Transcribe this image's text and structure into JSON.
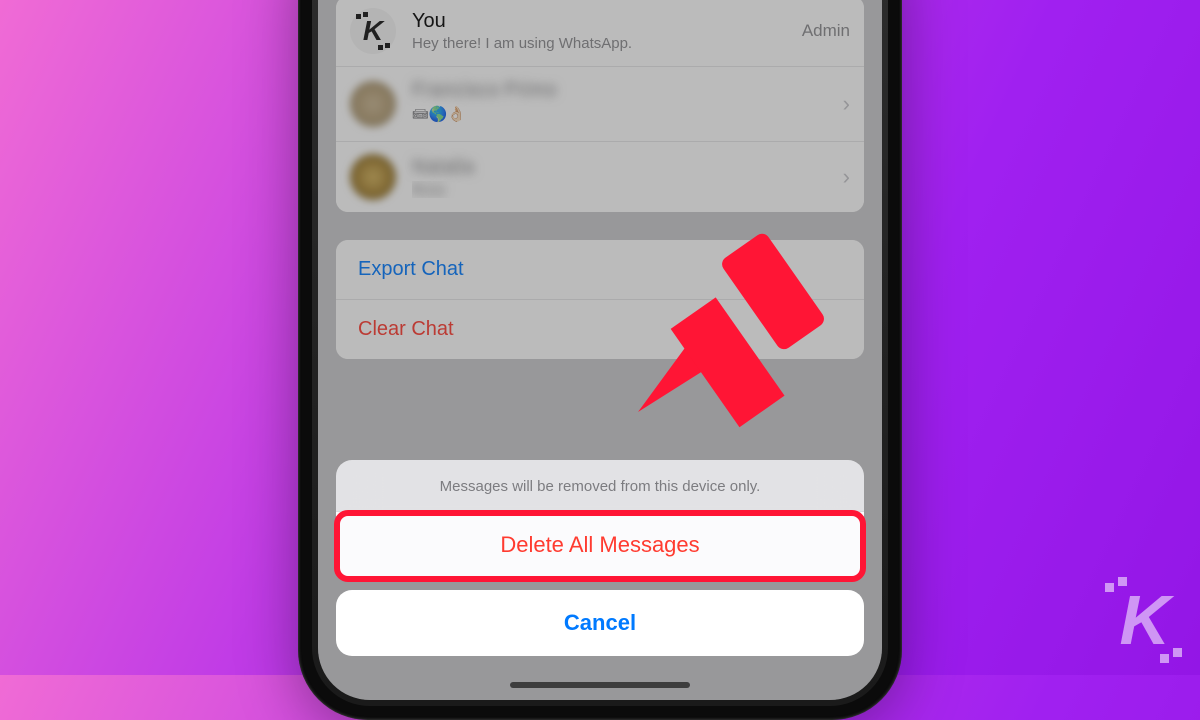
{
  "participants": {
    "you": {
      "name": "You",
      "status": "Hey there! I am using WhatsApp.",
      "role": "Admin"
    },
    "p2": {
      "status_emoji": "📾🌎👌🏻"
    }
  },
  "chat_actions": {
    "export": "Export Chat",
    "clear": "Clear Chat"
  },
  "sheet": {
    "message": "Messages will be removed from this device only.",
    "delete_all": "Delete All Messages",
    "cancel": "Cancel"
  },
  "colors": {
    "ios_blue": "#007aff",
    "ios_red": "#ff3b30",
    "highlight": "#ff1535"
  },
  "watermark": "K"
}
